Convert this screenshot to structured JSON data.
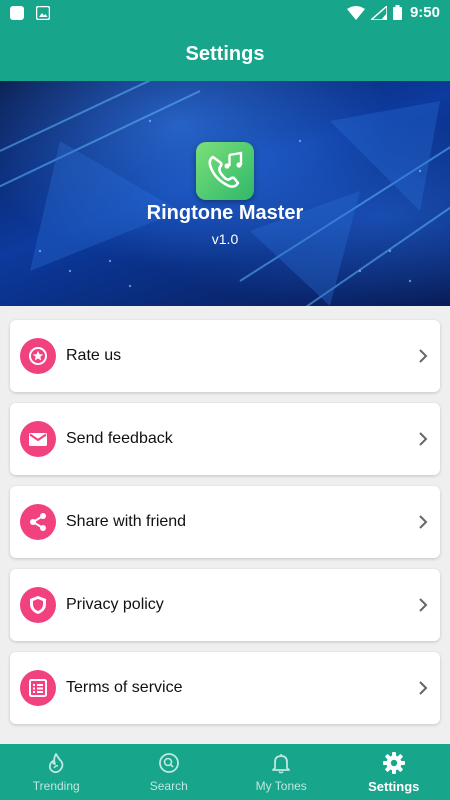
{
  "status_bar": {
    "time": "9:50"
  },
  "app_bar": {
    "title": "Settings"
  },
  "banner": {
    "app_name": "Ringtone Master",
    "version": "v1.0"
  },
  "menu": [
    {
      "label": "Rate us",
      "icon": "star-icon"
    },
    {
      "label": "Send feedback",
      "icon": "mail-icon"
    },
    {
      "label": "Share with friend",
      "icon": "share-icon"
    },
    {
      "label": "Privacy policy",
      "icon": "shield-icon"
    },
    {
      "label": "Terms of service",
      "icon": "document-icon"
    }
  ],
  "bottom_nav": [
    {
      "label": "Trending",
      "icon": "flame-icon"
    },
    {
      "label": "Search",
      "icon": "search-icon"
    },
    {
      "label": "My Tones",
      "icon": "bell-icon"
    },
    {
      "label": "Settings",
      "icon": "gear-icon",
      "active": true
    }
  ],
  "colors": {
    "primary": "#17a58c",
    "accent": "#f2417f",
    "card": "#ffffff",
    "background": "#efefef"
  }
}
